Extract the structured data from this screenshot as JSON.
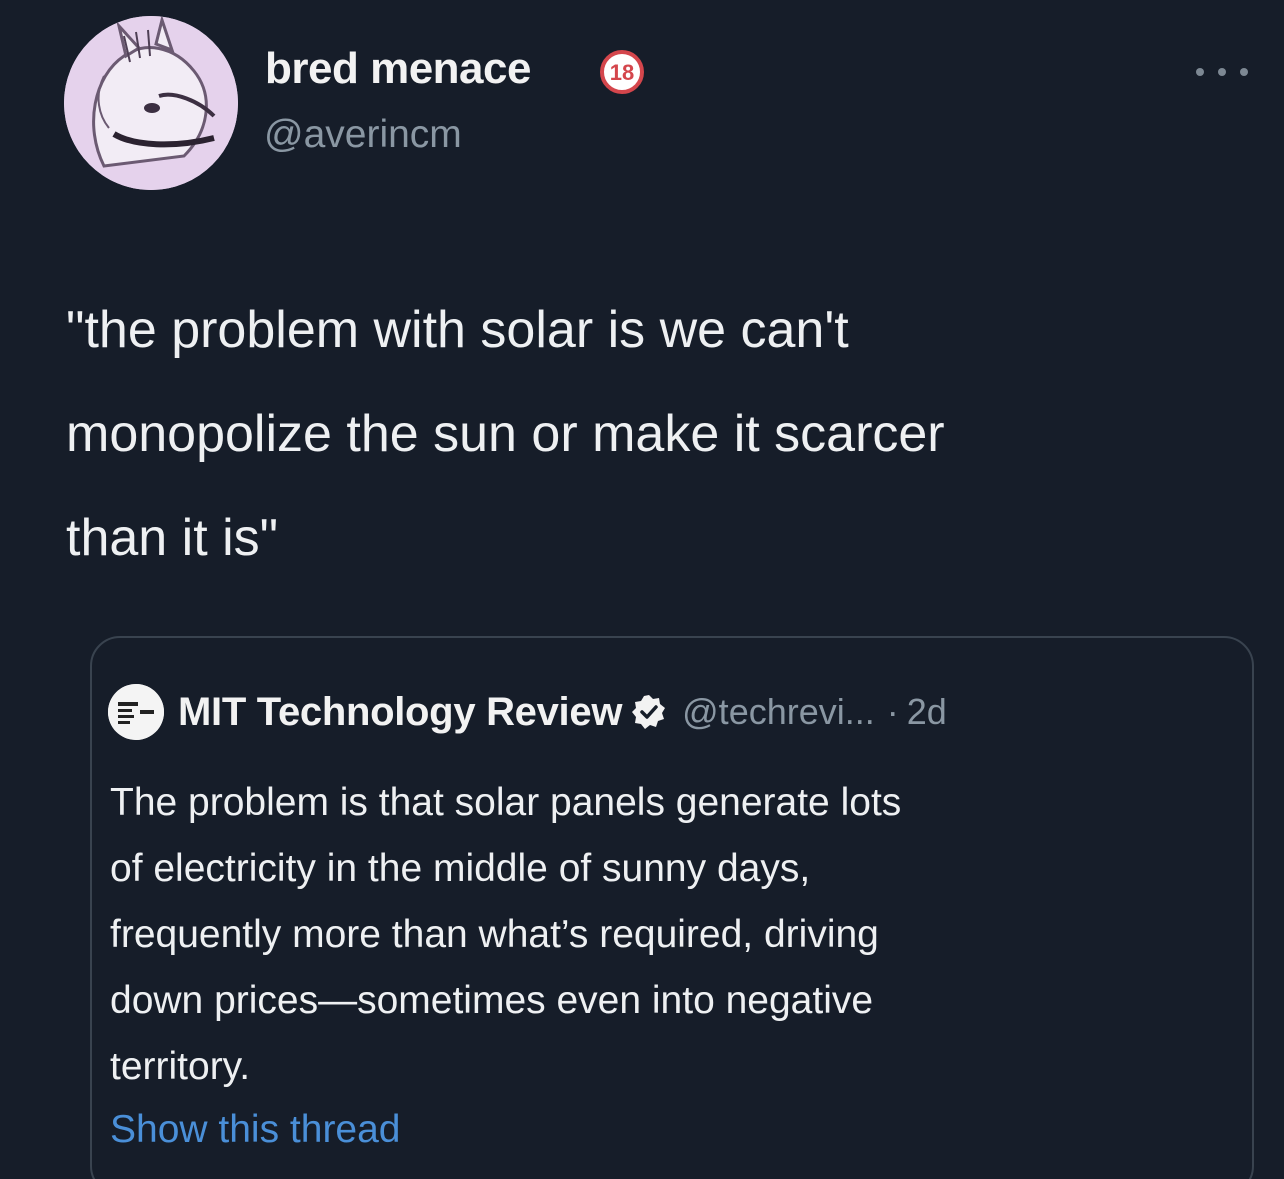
{
  "tweet": {
    "author": {
      "display_name": "bred menace",
      "badge": "18",
      "handle": "@averincm",
      "avatar_icon": "furry-character-avatar"
    },
    "more_icon": "more-horizontal-icon",
    "text_lines": [
      "\"the problem with solar is we can't",
      "monopolize the sun or make it scarcer",
      "than it is\""
    ],
    "quote": {
      "author": {
        "display_name": "MIT Technology Review",
        "handle": "@techrevi...",
        "separator": "·",
        "time": "2d",
        "verified_icon": "verified-badge-icon"
      },
      "text_lines": [
        "The problem is that solar panels generate lots",
        "of electricity in the middle of sunny days,",
        "frequently more than what’s required, driving",
        "down prices—sometimes even into negative",
        "territory."
      ],
      "show_thread": "Show this thread"
    }
  },
  "colors": {
    "background": "#161d29",
    "text": "#eef0f2",
    "secondary_text": "#8a97a3",
    "link": "#4a8fd8",
    "badge_red": "#d4464c"
  }
}
